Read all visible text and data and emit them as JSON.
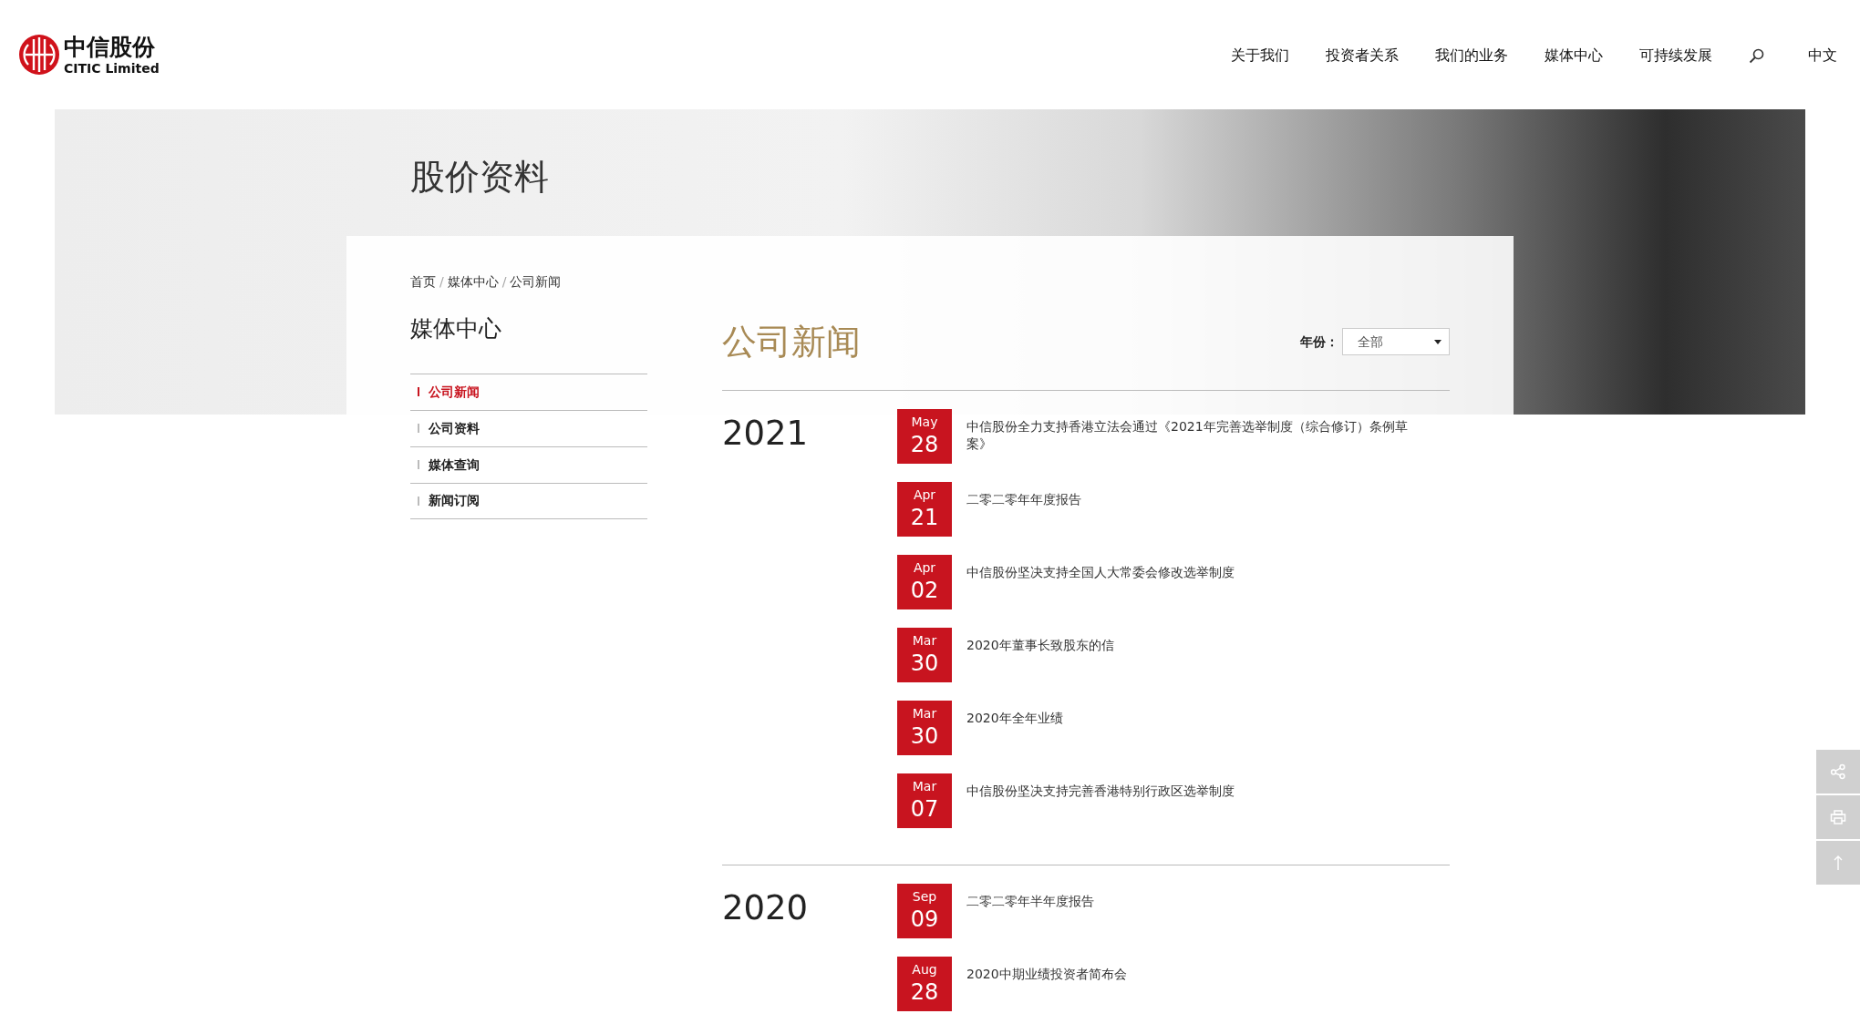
{
  "header": {
    "logo": {
      "name": "中信股份",
      "subtitle": "CITIC Limited"
    },
    "nav": [
      "关于我们",
      "投资者关系",
      "我们的业务",
      "媒体中心",
      "可持续发展"
    ],
    "language": "中文"
  },
  "banner": {
    "title": "股价资料"
  },
  "breadcrumb": {
    "separator": "/",
    "items": [
      "首页",
      "媒体中心",
      "公司新闻"
    ]
  },
  "sidebar": {
    "title": "媒体中心",
    "items": [
      {
        "label": "公司新闻",
        "selected": true
      },
      {
        "label": "公司资料",
        "selected": false
      },
      {
        "label": "媒体查询",
        "selected": false
      },
      {
        "label": "新闻订阅",
        "selected": false
      }
    ]
  },
  "news": {
    "title": "公司新闻",
    "year_filter": {
      "label": "年份：",
      "value": "全部"
    },
    "groups": [
      {
        "year": "2021",
        "items": [
          {
            "month": "May",
            "day": "28",
            "title": "中信股份全力支持香港立法会通过《2021年完善选举制度（综合修订）条例草案》"
          },
          {
            "month": "Apr",
            "day": "21",
            "title": "二零二零年年度报告"
          },
          {
            "month": "Apr",
            "day": "02",
            "title": "中信股份坚决支持全国人大常委会修改选举制度"
          },
          {
            "month": "Mar",
            "day": "30",
            "title": "2020年董事长致股东的信"
          },
          {
            "month": "Mar",
            "day": "30",
            "title": "2020年全年业绩"
          },
          {
            "month": "Mar",
            "day": "07",
            "title": "中信股份坚决支持完善香港特别行政区选举制度"
          }
        ]
      },
      {
        "year": "2020",
        "items": [
          {
            "month": "Sep",
            "day": "09",
            "title": "二零二零年半年度报告"
          },
          {
            "month": "Aug",
            "day": "28",
            "title": "2020中期业绩投资者简布会"
          }
        ]
      }
    ]
  }
}
